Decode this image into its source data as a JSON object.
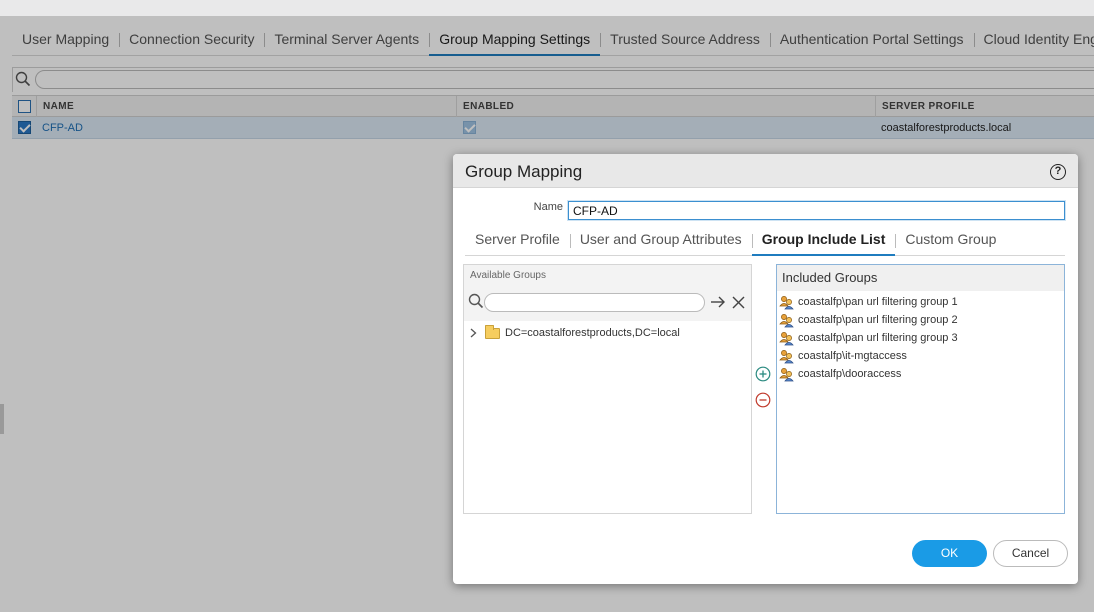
{
  "main_tabs": [
    {
      "label": "User Mapping"
    },
    {
      "label": "Connection Security"
    },
    {
      "label": "Terminal Server Agents"
    },
    {
      "label": "Group Mapping Settings"
    },
    {
      "label": "Trusted Source Address"
    },
    {
      "label": "Authentication Portal Settings"
    },
    {
      "label": "Cloud Identity Engine"
    }
  ],
  "grid": {
    "columns": [
      "NAME",
      "ENABLED",
      "SERVER PROFILE"
    ],
    "rows": [
      {
        "name": "CFP-AD",
        "enabled": true,
        "server_profile": "coastalforestproducts.local",
        "selected": true
      }
    ]
  },
  "dialog": {
    "title": "Group Mapping",
    "help_glyph": "?",
    "name_label": "Name",
    "name_value": "CFP-AD",
    "tabs": [
      {
        "label": "Server Profile"
      },
      {
        "label": "User and Group Attributes"
      },
      {
        "label": "Group Include List"
      },
      {
        "label": "Custom Group"
      }
    ],
    "active_tab": "Group Include List",
    "available_groups": {
      "title": "Available Groups",
      "search_placeholder": "",
      "tree": [
        {
          "label": "DC=coastalforestproducts,DC=local",
          "expanded": false
        }
      ]
    },
    "included_groups": {
      "title": "Included Groups",
      "items": [
        "coastalfp\\pan url filtering group 1",
        "coastalfp\\pan url filtering group 2",
        "coastalfp\\pan url filtering group 3",
        "coastalfp\\it-mgtaccess",
        "coastalfp\\dooraccess"
      ]
    },
    "ok_label": "OK",
    "cancel_label": "Cancel"
  },
  "colors": {
    "accent": "#1f7cbf",
    "ok_button": "#1a9be6",
    "selected_row": "#dbe9f5",
    "add_icon": "#2a8a80",
    "remove_icon": "#c0392b"
  }
}
